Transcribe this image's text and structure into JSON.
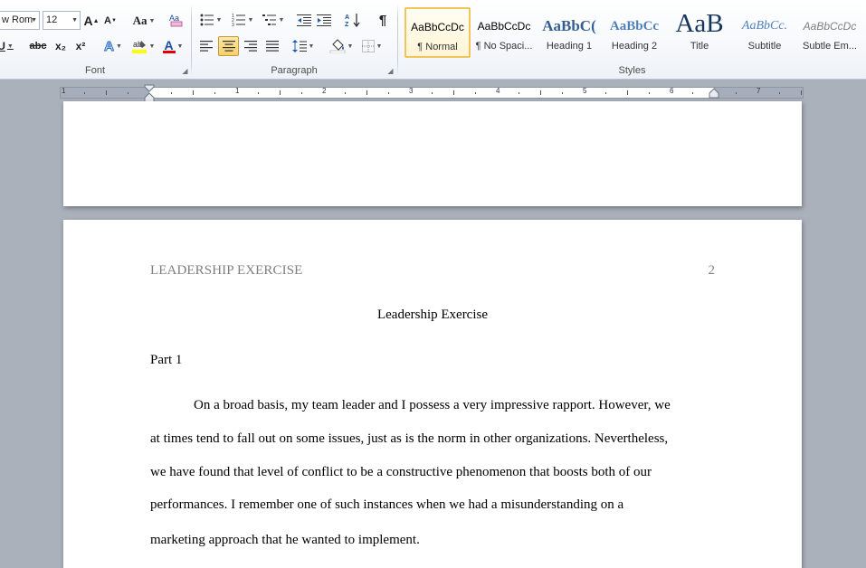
{
  "ribbon": {
    "font": {
      "font_name": "w Rom",
      "font_size": "12",
      "group_label": "Font",
      "grow_label": "A",
      "shrink_label": "A",
      "change_case_label": "Aa",
      "underline_label": "U",
      "strike_label": "abc",
      "subscript_label": "x₂",
      "superscript_label": "x²",
      "effects_label": "A",
      "font_color_label": "A",
      "highlight_color": "#ffff00",
      "font_color": "#e00000"
    },
    "paragraph": {
      "group_label": "Paragraph",
      "show_marks_label": "¶"
    },
    "styles": {
      "group_label": "Styles",
      "items": [
        {
          "sample": "AaBbCcDc",
          "name": "¶ Normal",
          "selected": true
        },
        {
          "sample": "AaBbCcDc",
          "name": "¶ No Spaci...",
          "selected": false
        },
        {
          "sample": "AaBbC(",
          "name": "Heading 1",
          "selected": false
        },
        {
          "sample": "AaBbCc",
          "name": "Heading 2",
          "selected": false
        },
        {
          "sample": "AaB",
          "name": "Title",
          "selected": false
        },
        {
          "sample": "AaBbCc.",
          "name": "Subtitle",
          "selected": false
        },
        {
          "sample": "AaBbCcDc",
          "name": "Subtle Em...",
          "selected": false
        }
      ]
    }
  },
  "ruler": {
    "numbers": [
      "1",
      "1",
      "2",
      "3",
      "4",
      "5",
      "6",
      "7"
    ]
  },
  "document": {
    "header_left": "LEADERSHIP EXERCISE",
    "page_number": "2",
    "title": "Leadership Exercise",
    "part": "Part 1",
    "lines": [
      "On a broad basis, my team leader and I possess a very impressive rapport. However, we",
      "at times tend to fall out on some issues, just as is the norm in other organizations. Nevertheless,",
      "we have found that level of conflict to be a constructive phenomenon that boosts both of our",
      "performances. I remember one of such instances when we had a misunderstanding on a",
      "marketing approach that he wanted to implement."
    ]
  }
}
